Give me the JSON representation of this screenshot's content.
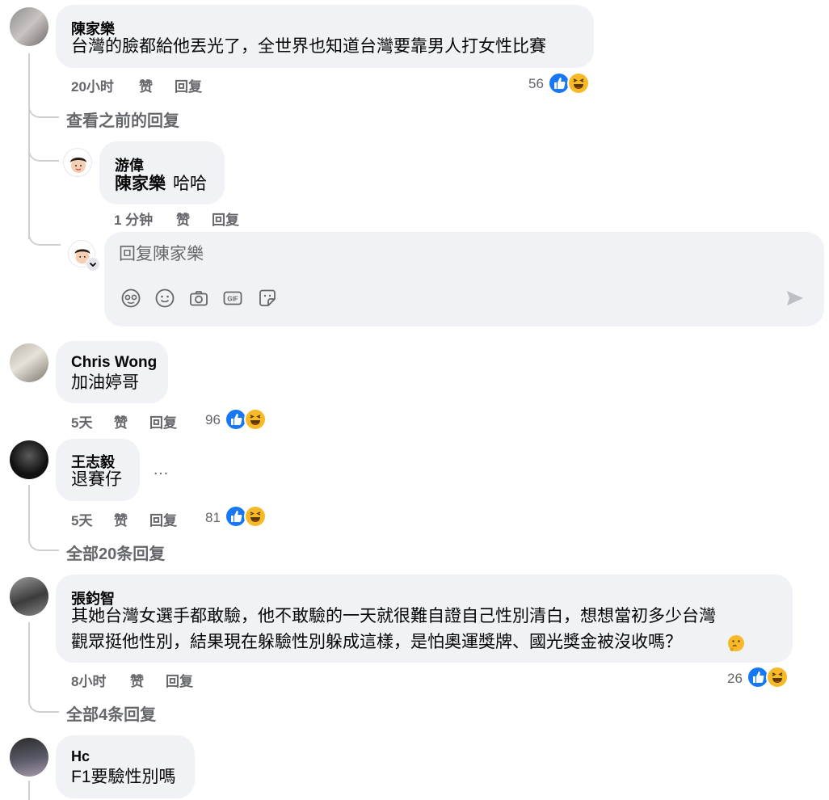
{
  "comments": [
    {
      "author": "陳家樂",
      "text": "台灣的臉都給他丟光了，全世界也知道台灣要靠男人打女性比賽",
      "time": "20小时",
      "like": "赞",
      "reply": "回复",
      "reaction_count": "56"
    },
    {
      "author": "Chris Wong",
      "text": "加油婷哥",
      "time": "5天",
      "like": "赞",
      "reply": "回复",
      "reaction_count": "96"
    },
    {
      "author": "王志毅",
      "text": "退賽仔",
      "more": "…",
      "time": "5天",
      "like": "赞",
      "reply": "回复",
      "reaction_count": "81"
    },
    {
      "author": "張鈞智",
      "text_line1": "其她台灣女選手都敢驗，他不敢驗的一天就很難自證自己性別清白，想想當初多少台灣",
      "text_line2": "觀眾挺他性別，結果現在躲驗性別躲成這樣，是怕奧運獎牌、國光獎金被沒收嗎？",
      "time": "8小时",
      "like": "赞",
      "reply": "回复",
      "reaction_count": "26"
    },
    {
      "author": "Hc",
      "text": "F1要驗性別嗎"
    }
  ],
  "threads": {
    "view_previous": "查看之前的回复",
    "all_replies_20": "全部20条回复",
    "all_replies_4": "全部4条回复"
  },
  "reply": {
    "author": "游偉",
    "mention": "陳家樂",
    "text": "哈哈",
    "time": "1 分钟",
    "like": "赞",
    "reply": "回复"
  },
  "composer": {
    "placeholder": "回复陳家樂",
    "icons": [
      "avatar-sticker-icon",
      "emoji-icon",
      "camera-icon",
      "gif-icon",
      "sticker-icon",
      "send-icon"
    ]
  },
  "colors": {
    "bubble": "#f0f2f5",
    "meta": "#65676b",
    "like_blue": "#1877f2",
    "haha_yellow": "#f7b928",
    "thread": "#ced0d4"
  }
}
